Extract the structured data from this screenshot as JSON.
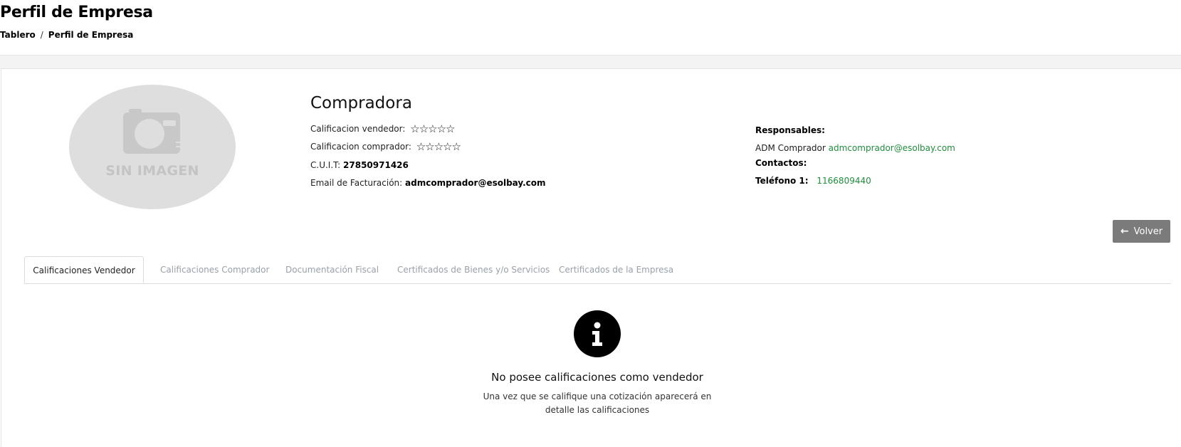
{
  "header": {
    "title": "Perfil de Empresa",
    "breadcrumb": {
      "home": "Tablero",
      "separator": "/",
      "current": "Perfil de Empresa"
    }
  },
  "profile": {
    "image_placeholder": "SIN IMAGEN",
    "company_name": "Compradora",
    "seller_rating": {
      "label": "Calificacion vendedor:",
      "stars": "☆☆☆☆☆",
      "value": 0,
      "max": 5
    },
    "buyer_rating": {
      "label": "Calificacion comprador:",
      "stars": "☆☆☆☆☆",
      "value": 0,
      "max": 5
    },
    "cuit": {
      "label": "C.U.I.T:",
      "value": "27850971426"
    },
    "billing_email": {
      "label": "Email de Facturación:",
      "value": "admcomprador@esolbay.com"
    }
  },
  "responsables": {
    "label": "Responsables:",
    "name": "ADM Comprador",
    "email": "admcomprador@esolbay.com"
  },
  "contactos": {
    "label": "Contactos:",
    "phone_label": "Teléfono 1:",
    "phone_value": "1166809440"
  },
  "actions": {
    "back_label": "Volver"
  },
  "tabs": [
    {
      "label": "Calificaciones Vendedor",
      "active": true
    },
    {
      "label": "Calificaciones Comprador",
      "active": false
    },
    {
      "label": "Documentación Fiscal",
      "active": false
    },
    {
      "label": "Certificados de Bienes y/o Servicios",
      "active": false
    },
    {
      "label": "Certificados de la Empresa",
      "active": false
    }
  ],
  "empty_state": {
    "icon": "info-icon",
    "title": "No posee calificaciones como vendedor",
    "description": "Una vez que se califique una cotización aparecerá en detalle las calificaciones"
  },
  "colors": {
    "accent_green": "#1e8f3c",
    "button_gray": "#7b7b7b",
    "tab_inactive": "#9aa0aa",
    "placeholder_bg": "#dedede"
  }
}
